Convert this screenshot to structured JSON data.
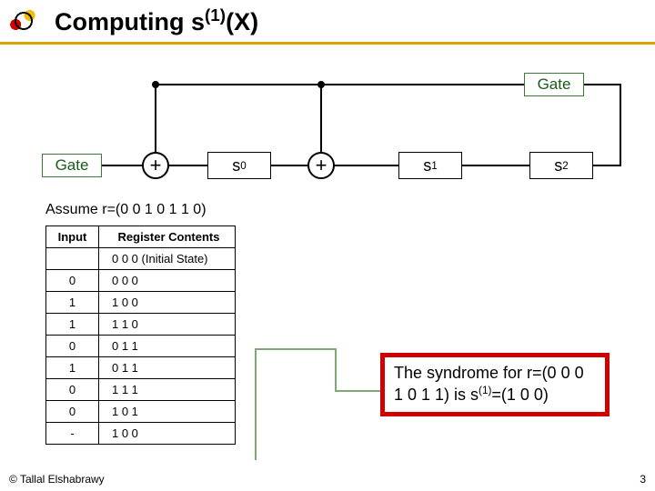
{
  "title_html": "Computing s<sup>(1)</sup>(X)",
  "circuit": {
    "gate_label": "Gate",
    "input_gate_label": "Gate",
    "adder1": "+",
    "adder2": "+",
    "reg0_html": "s<sub>0</sub>",
    "reg1_html": "s<sub>1</sub>",
    "reg2_html": "s<sub>2</sub>"
  },
  "assume": "Assume r=(0 0 1 0 1 1 0)",
  "table": {
    "head_input": "Input",
    "head_reg": "Register Contents",
    "rows": [
      {
        "in": "",
        "reg": "0 0 0 (Initial State)"
      },
      {
        "in": "0",
        "reg": "0 0 0"
      },
      {
        "in": "1",
        "reg": "1 0 0"
      },
      {
        "in": "1",
        "reg": "1 1 0"
      },
      {
        "in": "0",
        "reg": "0 1 1"
      },
      {
        "in": "1",
        "reg": "0 1 1"
      },
      {
        "in": "0",
        "reg": "1 1 1"
      },
      {
        "in": "0",
        "reg": "1 0 1"
      },
      {
        "in": "-",
        "reg": "1 0 0"
      }
    ]
  },
  "syndrome_html": "The syndrome for r=(0 0 0 1 0 1 1) is s<sup>(1)</sup>=(1 0 0)",
  "footer": {
    "copyright": "© Tallal Elshabrawy",
    "page": "3"
  },
  "chart_data": {
    "type": "table",
    "title": "LFSR state table for computing s^(1)(X)",
    "columns": [
      "Input",
      "Register Contents"
    ],
    "rows": [
      [
        "",
        "0 0 0 (Initial State)"
      ],
      [
        "0",
        "0 0 0"
      ],
      [
        "1",
        "1 0 0"
      ],
      [
        "1",
        "1 1 0"
      ],
      [
        "0",
        "0 1 1"
      ],
      [
        "1",
        "0 1 1"
      ],
      [
        "0",
        "1 1 1"
      ],
      [
        "0",
        "1 0 1"
      ],
      [
        "-",
        "1 0 0"
      ]
    ],
    "annotation": "Syndrome for r=(0 0 0 1 0 1 1) is s^(1)=(1 0 0)"
  }
}
